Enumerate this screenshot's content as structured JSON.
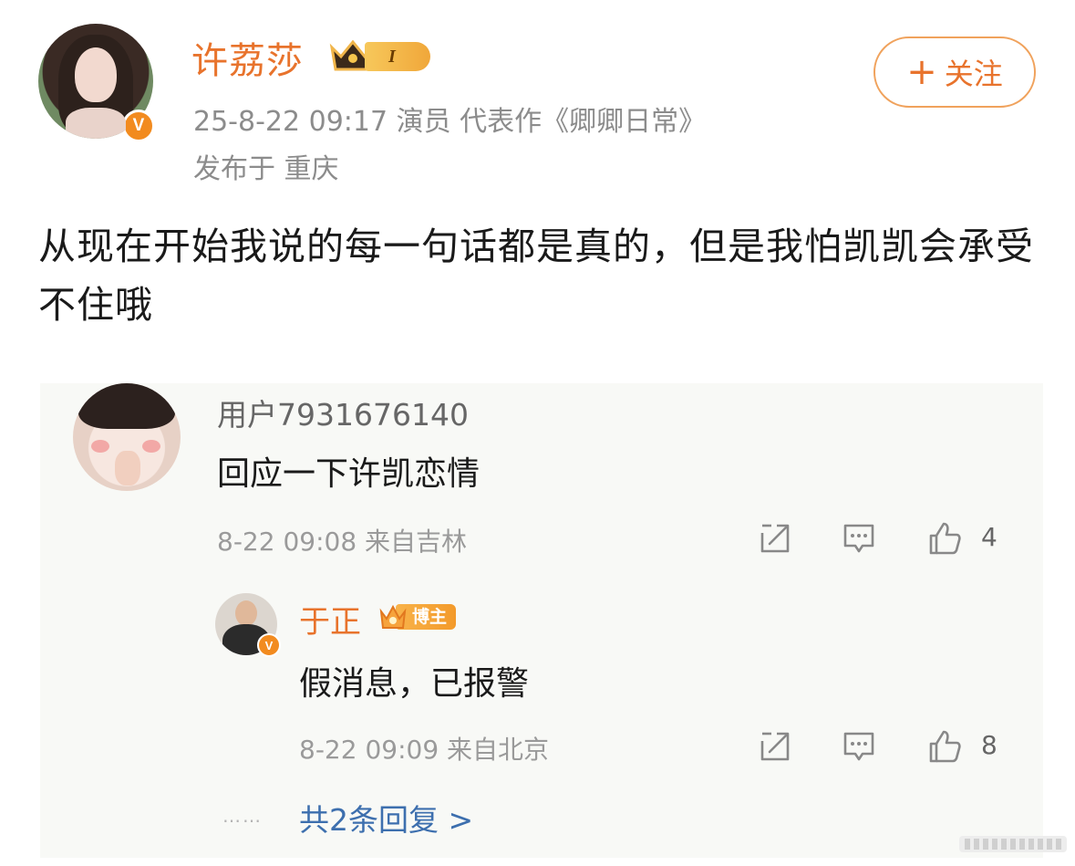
{
  "post": {
    "author": "许荔莎",
    "vip_level": "I",
    "meta": "25-8-22 09:17  演员 代表作《卿卿日常》",
    "location": "发布于 重庆",
    "follow_label": "关注",
    "follow_plus": "+",
    "text": "从现在开始我说的每一句话都是真的，但是我怕凯凯会承受不住哦"
  },
  "comments": [
    {
      "user": "用户7931676140",
      "text": "回应一下许凯恋情",
      "time": "8-22 09:08 来自吉林",
      "likes": "4"
    }
  ],
  "reply": {
    "user": "于正",
    "badge": "博主",
    "text": "假消息，已报警",
    "time": "8-22 09:09 来自北京",
    "likes": "8"
  },
  "more_replies": "共2条回复 >",
  "more_dots": "……",
  "colors": {
    "accent_orange": "#e8732c",
    "link_blue": "#3d6fae",
    "comment_bg": "#f8f9f6",
    "meta_gray": "#8c8c8c"
  },
  "icons": [
    "verified-icon",
    "vip-crown-icon",
    "share-icon",
    "comment-icon",
    "like-icon",
    "bozhu-crown-icon"
  ]
}
